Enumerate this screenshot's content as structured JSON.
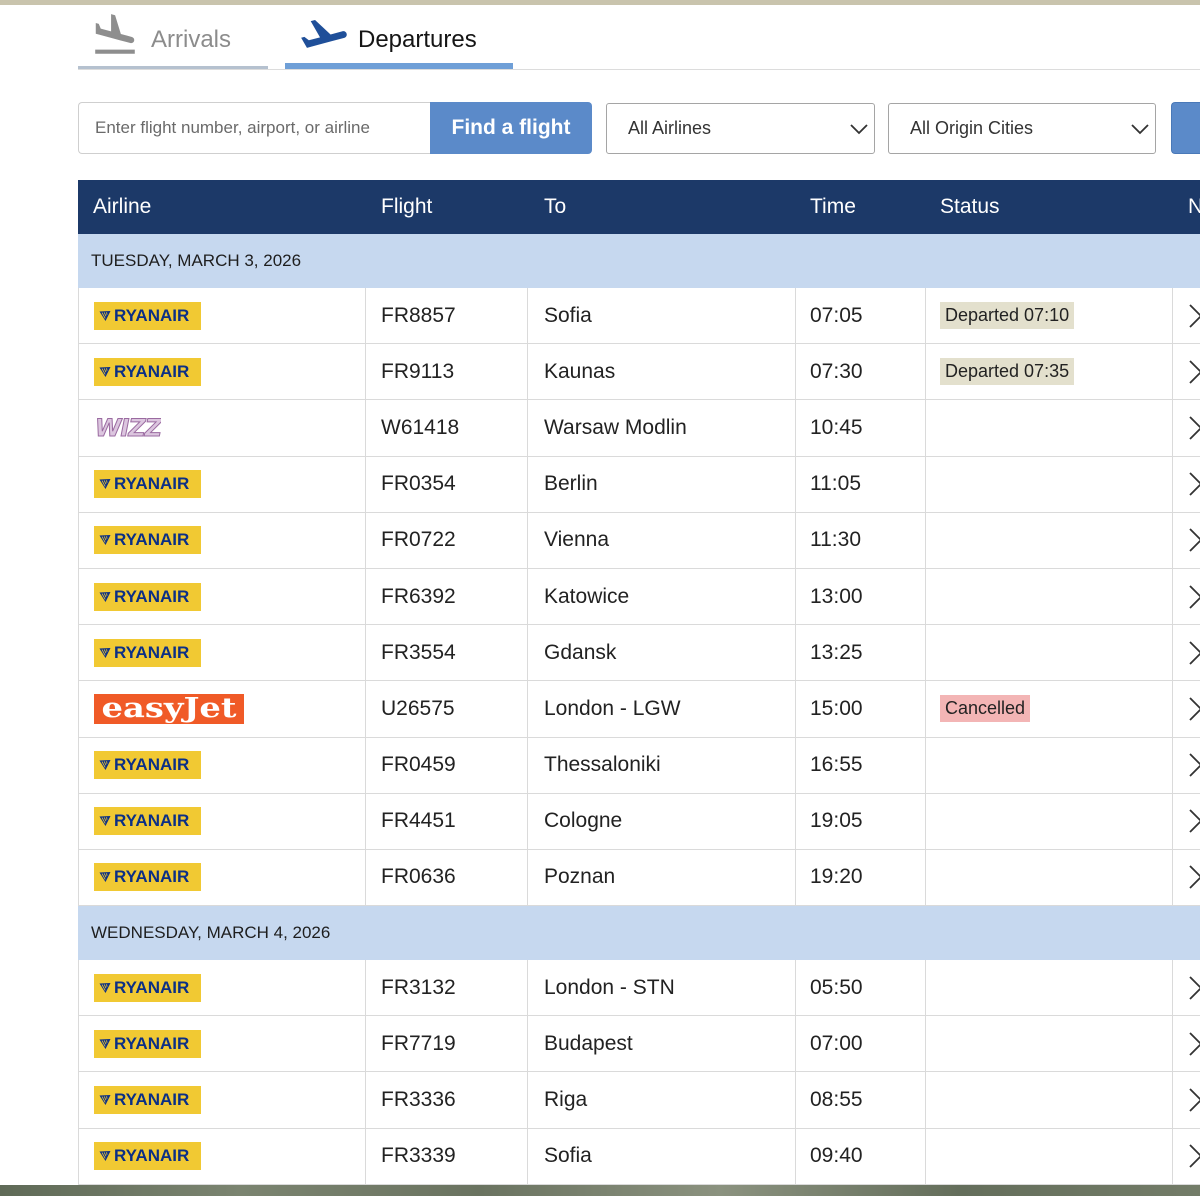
{
  "tabs": [
    {
      "label": "Arrivals",
      "icon": "plane-arrival-icon",
      "active": false
    },
    {
      "label": "Departures",
      "icon": "plane-departure-icon",
      "active": true
    }
  ],
  "search": {
    "placeholder": "Enter flight number, airport, or airline",
    "value": "",
    "button_label": "Find a flight",
    "airline_filter": "All Airlines",
    "city_filter": "All Origin Cities"
  },
  "colors": {
    "header_bg": "#1c3968",
    "date_row_bg": "#c6d8ef",
    "accent_blue": "#5b8ac9",
    "active_tab_underline": "#6f9fd7"
  },
  "airline_logos": {
    "ryanair-logo": {
      "text": "RYANAIR",
      "bg": "#f1c933",
      "fg": "#0b2f86"
    },
    "wizz-logo": {
      "text": "WIZZ",
      "bg": "#ffffff",
      "fg": "#dcc6df"
    },
    "easyjet-logo": {
      "text": "easyJet",
      "bg": "#f05a27",
      "fg": "#ffffff"
    }
  },
  "table": {
    "columns": [
      "Airline",
      "Flight",
      "To",
      "Time",
      "Status",
      "N"
    ],
    "row_action_icon": "chevron-right-icon",
    "groups": [
      {
        "date": "TUESDAY, MARCH 3, 2026",
        "rows": [
          {
            "logo": "ryanair-logo",
            "flight": "FR8857",
            "to": "Sofia",
            "time": "07:05",
            "status": "Departed 07:10",
            "status_bg": "#e3e0cd"
          },
          {
            "logo": "ryanair-logo",
            "flight": "FR9113",
            "to": "Kaunas",
            "time": "07:30",
            "status": "Departed 07:35",
            "status_bg": "#e3e0cd"
          },
          {
            "logo": "wizz-logo",
            "flight": "W61418",
            "to": "Warsaw Modlin",
            "time": "10:45"
          },
          {
            "logo": "ryanair-logo",
            "flight": "FR0354",
            "to": "Berlin",
            "time": "11:05"
          },
          {
            "logo": "ryanair-logo",
            "flight": "FR0722",
            "to": "Vienna",
            "time": "11:30"
          },
          {
            "logo": "ryanair-logo",
            "flight": "FR6392",
            "to": "Katowice",
            "time": "13:00"
          },
          {
            "logo": "ryanair-logo",
            "flight": "FR3554",
            "to": "Gdansk",
            "time": "13:25"
          },
          {
            "logo": "easyjet-logo",
            "flight": "U26575",
            "to": "London - LGW",
            "time": "15:00",
            "status": "Cancelled",
            "status_bg": "#f3b5b5"
          },
          {
            "logo": "ryanair-logo",
            "flight": "FR0459",
            "to": "Thessaloniki",
            "time": "16:55"
          },
          {
            "logo": "ryanair-logo",
            "flight": "FR4451",
            "to": "Cologne",
            "time": "19:05"
          },
          {
            "logo": "ryanair-logo",
            "flight": "FR0636",
            "to": "Poznan",
            "time": "19:20"
          }
        ]
      },
      {
        "date": "WEDNESDAY, MARCH 4, 2026",
        "rows": [
          {
            "logo": "ryanair-logo",
            "flight": "FR3132",
            "to": "London - STN",
            "time": "05:50"
          },
          {
            "logo": "ryanair-logo",
            "flight": "FR7719",
            "to": "Budapest",
            "time": "07:00"
          },
          {
            "logo": "ryanair-logo",
            "flight": "FR3336",
            "to": "Riga",
            "time": "08:55"
          },
          {
            "logo": "ryanair-logo",
            "flight": "FR3339",
            "to": "Sofia",
            "time": "09:40"
          }
        ]
      }
    ]
  }
}
